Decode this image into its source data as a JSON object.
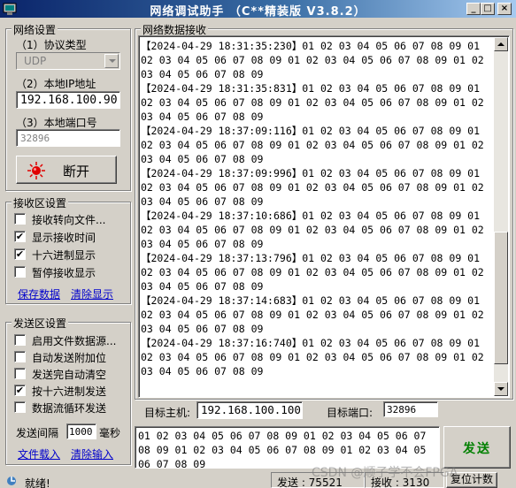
{
  "window": {
    "title": "网络调试助手 （C**精装版 V3.8.2）",
    "min_glyph": "_",
    "max_glyph": "□",
    "close_glyph": "×"
  },
  "net_settings": {
    "group_label": "网络设置",
    "protocol_label": "（1）协议类型",
    "protocol_value": "UDP",
    "ip_label": "（2）本地IP地址",
    "ip_value": "192.168.100.90",
    "port_label": "（3）本地端口号",
    "port_value": "32896",
    "connect_button": "断开",
    "connect_indicator_color": "#e00000"
  },
  "recv_settings": {
    "group_label": "接收区设置",
    "options": [
      {
        "label": "接收转向文件...",
        "checked": false
      },
      {
        "label": "显示接收时间",
        "checked": true
      },
      {
        "label": "十六进制显示",
        "checked": true
      },
      {
        "label": "暂停接收显示",
        "checked": false
      }
    ],
    "save_link": "保存数据",
    "clear_link": "清除显示"
  },
  "send_settings": {
    "group_label": "发送区设置",
    "options": [
      {
        "label": "启用文件数据源...",
        "checked": false
      },
      {
        "label": "自动发送附加位",
        "checked": false
      },
      {
        "label": "发送完自动清空",
        "checked": false
      },
      {
        "label": "按十六进制发送",
        "checked": true
      },
      {
        "label": "数据流循环发送",
        "checked": false
      }
    ],
    "interval_label": "发送间隔",
    "interval_value": "1000",
    "interval_unit": "毫秒",
    "load_link": "文件载入",
    "clear_input_link": "清除输入"
  },
  "receive": {
    "group_label": "网络数据接收",
    "log": "【2024-04-29 18:31:35:230】01 02 03 04 05 06 07 08 09 01 02 03 04 05 06 07 08 09 01 02 03 04 05 06 07 08 09 01 02 03 04 05 06 07 08 09\n【2024-04-29 18:31:35:831】01 02 03 04 05 06 07 08 09 01 02 03 04 05 06 07 08 09 01 02 03 04 05 06 07 08 09 01 02 03 04 05 06 07 08 09\n【2024-04-29 18:37:09:116】01 02 03 04 05 06 07 08 09 01 02 03 04 05 06 07 08 09 01 02 03 04 05 06 07 08 09 01 02 03 04 05 06 07 08 09\n【2024-04-29 18:37:09:996】01 02 03 04 05 06 07 08 09 01 02 03 04 05 06 07 08 09 01 02 03 04 05 06 07 08 09 01 02 03 04 05 06 07 08 09\n【2024-04-29 18:37:10:686】01 02 03 04 05 06 07 08 09 01 02 03 04 05 06 07 08 09 01 02 03 04 05 06 07 08 09 01 02 03 04 05 06 07 08 09\n【2024-04-29 18:37:13:796】01 02 03 04 05 06 07 08 09 01 02 03 04 05 06 07 08 09 01 02 03 04 05 06 07 08 09 01 02 03 04 05 06 07 08 09\n【2024-04-29 18:37:14:683】01 02 03 04 05 06 07 08 09 01 02 03 04 05 06 07 08 09 01 02 03 04 05 06 07 08 09 01 02 03 04 05 06 07 08 09\n【2024-04-29 18:37:16:740】01 02 03 04 05 06 07 08 09 01 02 03 04 05 06 07 08 09 01 02 03 04 05 06 07 08 09 01 02 03 04 05 06 07 08 09"
  },
  "target": {
    "host_label": "目标主机:",
    "host_value": "192.168.100.100",
    "port_label": "目标端口:",
    "port_value": "32896"
  },
  "send": {
    "input": "01 02 03 04 05 06 07 08 09 01 02 03 04 05 06 07 08 09 01 02 03 04 05 06 07 08 09 01 02 03 04 05 06 07 08 09",
    "button": "发送"
  },
  "status": {
    "ready": "就绪!",
    "sent": "发送 : 75521",
    "received": "接收 : 3130",
    "reset": "复位计数"
  },
  "watermark": "CSDN @顺子学不会FPGA"
}
